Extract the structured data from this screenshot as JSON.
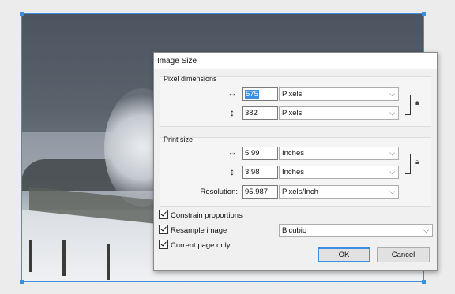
{
  "dialog": {
    "title": "Image Size",
    "pixel_dimensions": {
      "title": "Pixel dimensions",
      "width": {
        "arrow": "↔",
        "value": "575",
        "unit": "Pixels"
      },
      "height": {
        "arrow": "↕",
        "value": "382",
        "unit": "Pixels"
      }
    },
    "print_size": {
      "title": "Print size",
      "width": {
        "arrow": "↔",
        "value": "5.99",
        "unit": "Inches"
      },
      "height": {
        "arrow": "↕",
        "value": "3.98",
        "unit": "Inches"
      },
      "resolution": {
        "label": "Resolution:",
        "value": "95.987",
        "unit": "Pixels/Inch"
      }
    },
    "constrain_proportions": {
      "label": "Constrain proportions",
      "checked": true
    },
    "resample_image": {
      "label": "Resample image",
      "checked": true,
      "method": "Bicubic"
    },
    "current_page_only": {
      "label": "Current page only",
      "checked": true
    },
    "ok_label": "OK",
    "cancel_label": "Cancel",
    "lock_icon": "lock-icon",
    "chevron_icon": "chevron-down-icon"
  },
  "colors": {
    "selection": "#3c8fe0",
    "dialog_bg": "#f0f0f0"
  }
}
